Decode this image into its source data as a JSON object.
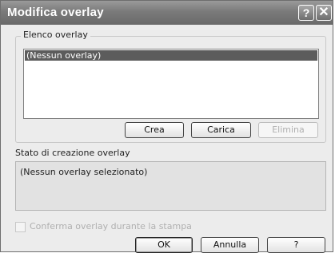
{
  "window": {
    "title": "Modifica overlay",
    "help_glyph": "?",
    "close_glyph": "✕"
  },
  "overlay_list": {
    "group_label": "Elenco overlay",
    "items": [
      "(Nessun overlay)"
    ],
    "selected_index": 0,
    "buttons": {
      "create": "Crea",
      "load": "Carica",
      "delete": "Elimina"
    }
  },
  "status": {
    "label": "Stato di creazione overlay",
    "text": "(Nessun overlay selezionato)"
  },
  "confirm": {
    "label": "Conferma overlay durante la stampa",
    "checked": false,
    "enabled": false
  },
  "footer": {
    "ok": "OK",
    "cancel": "Annulla",
    "help": "?"
  },
  "colors": {
    "titlebar": "#7a7a7a",
    "selection": "#5c5c5c",
    "dialog_bg": "#ececec"
  }
}
